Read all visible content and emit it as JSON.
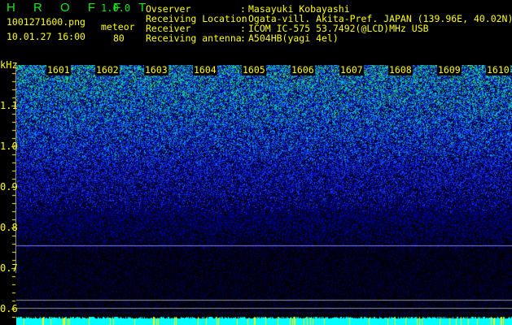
{
  "app": {
    "name": "H R O F F T",
    "version": "1.0.0"
  },
  "file": {
    "name": "1001271600.png",
    "datetime": "10.01.27 16:00"
  },
  "meteor": {
    "label": "meteor",
    "count": "80"
  },
  "info": [
    {
      "label": "Ovserver",
      "value": "Masayuki Kobayashi"
    },
    {
      "label": "Receiving Location",
      "value": "Ogata-vill. Akita-Pref. JAPAN (139.96E, 40.02N)"
    },
    {
      "label": "Receiver",
      "value": "ICOM IC-575 53.7492(@LCD)MHz USB"
    },
    {
      "label": "Receiving antenna",
      "value": "A504HB(yagi 4el)"
    }
  ],
  "axis": {
    "unit": "kHz",
    "ticks": [
      "1.1",
      "1.0",
      "0.9",
      "0.8",
      "0.7",
      "0.6"
    ]
  },
  "minutes": [
    "1601",
    "1602",
    "1603",
    "1604",
    "1605",
    "1606",
    "1607",
    "1608",
    "1609",
    "1610"
  ],
  "colors": {
    "title": "#19e619",
    "text": "#ffff00",
    "signal_line": "#8080ff",
    "meteor_bar": "#00ffff"
  }
}
